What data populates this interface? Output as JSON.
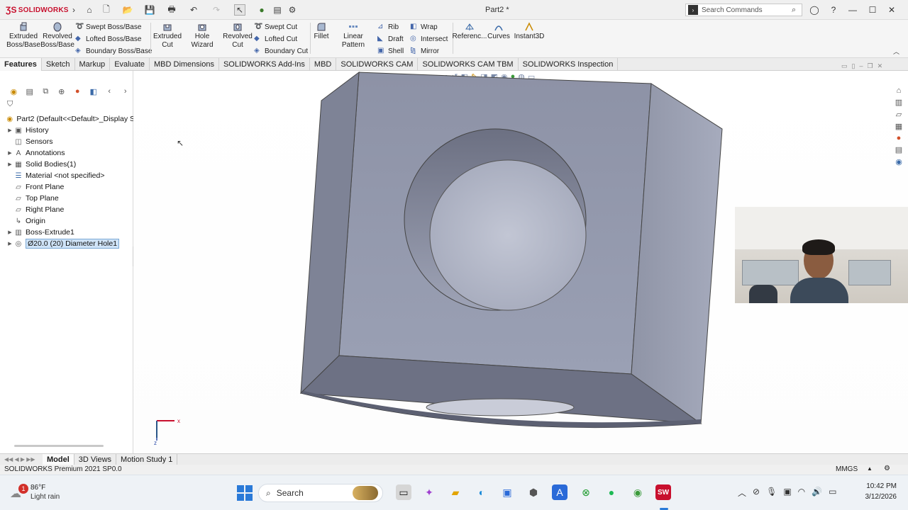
{
  "app": {
    "brand": "SOLIDWORKS",
    "brand_color": "#c8102e",
    "document_title": "Part2 *",
    "search_placeholder": "Search Commands"
  },
  "ribbon": {
    "extruded_boss": "Extruded Boss/Base",
    "revolved_boss": "Revolved Boss/Base",
    "swept_boss": "Swept Boss/Base",
    "lofted_boss": "Lofted Boss/Base",
    "boundary_boss": "Boundary Boss/Base",
    "extruded_cut": "Extruded Cut",
    "hole_wizard": "Hole Wizard",
    "revolved_cut": "Revolved Cut",
    "swept_cut": "Swept Cut",
    "lofted_cut": "Lofted Cut",
    "boundary_cut": "Boundary Cut",
    "fillet": "Fillet",
    "linear_pattern": "Linear Pattern",
    "rib": "Rib",
    "draft": "Draft",
    "shell": "Shell",
    "wrap": "Wrap",
    "intersect": "Intersect",
    "mirror": "Mirror",
    "reference": "Referenc...",
    "curves": "Curves",
    "instant3d": "Instant3D"
  },
  "tabs": [
    "Features",
    "Sketch",
    "Markup",
    "Evaluate",
    "MBD Dimensions",
    "SOLIDWORKS Add-Ins",
    "MBD",
    "SOLIDWORKS CAM",
    "SOLIDWORKS CAM TBM",
    "SOLIDWORKS Inspection"
  ],
  "feature_tree": {
    "root": "Part2  (Default<<Default>_Display S",
    "items": [
      {
        "label": "History",
        "icon": "history-icon",
        "expandable": true
      },
      {
        "label": "Sensors",
        "icon": "sensor-icon",
        "expandable": false
      },
      {
        "label": "Annotations",
        "icon": "annotation-icon",
        "expandable": true
      },
      {
        "label": "Solid Bodies(1)",
        "icon": "solid-body-icon",
        "expandable": true
      },
      {
        "label": "Material <not specified>",
        "icon": "material-icon",
        "expandable": false
      },
      {
        "label": "Front Plane",
        "icon": "plane-icon",
        "expandable": false
      },
      {
        "label": "Top Plane",
        "icon": "plane-icon",
        "expandable": false
      },
      {
        "label": "Right Plane",
        "icon": "plane-icon",
        "expandable": false
      },
      {
        "label": "Origin",
        "icon": "origin-icon",
        "expandable": false
      },
      {
        "label": "Boss-Extrude1",
        "icon": "extrude-icon",
        "expandable": true
      },
      {
        "label": "Ø20.0 (20) Diameter Hole1",
        "icon": "hole-icon",
        "expandable": true,
        "selected": true
      }
    ]
  },
  "bottom_tabs": [
    "Model",
    "3D Views",
    "Motion Study 1"
  ],
  "status": {
    "left": "SOLIDWORKS Premium 2021 SP0.0",
    "units": "MMGS"
  },
  "taskbar": {
    "weather_temp": "86°F",
    "weather_desc": "Light rain",
    "weather_badge": "1",
    "search_label": "Search",
    "time": "10:42 PM",
    "date": "3/12/2026"
  },
  "triad": {
    "x_label": "x",
    "z_label": "z"
  }
}
